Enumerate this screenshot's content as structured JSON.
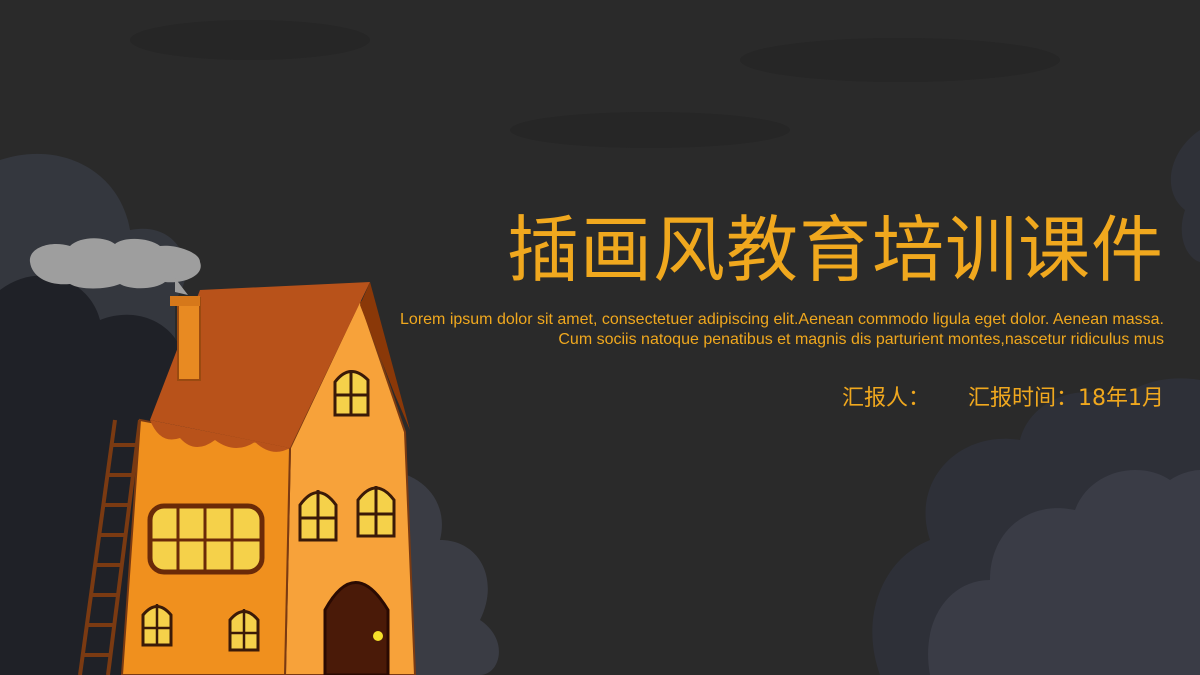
{
  "slide": {
    "title": "插画风教育培训课件",
    "description": "Lorem ipsum dolor sit amet, consectetuer adipiscing elit.Aenean commodo ligula eget dolor. Aenean massa. Cum sociis natoque penatibus et magnis dis parturient montes,nascetur ridiculus mus",
    "reporter_label": "汇报人：",
    "date_label": "汇报时间：18年1月"
  },
  "colors": {
    "background": "#2a2a2a",
    "accent": "#f0a81e",
    "house_body": "#f39a2a",
    "roof": "#b24a10",
    "window": "#f5d14a"
  },
  "icons": [
    "house-illustration",
    "cloud-icon",
    "ladder-icon",
    "smoke-cloud-icon"
  ]
}
